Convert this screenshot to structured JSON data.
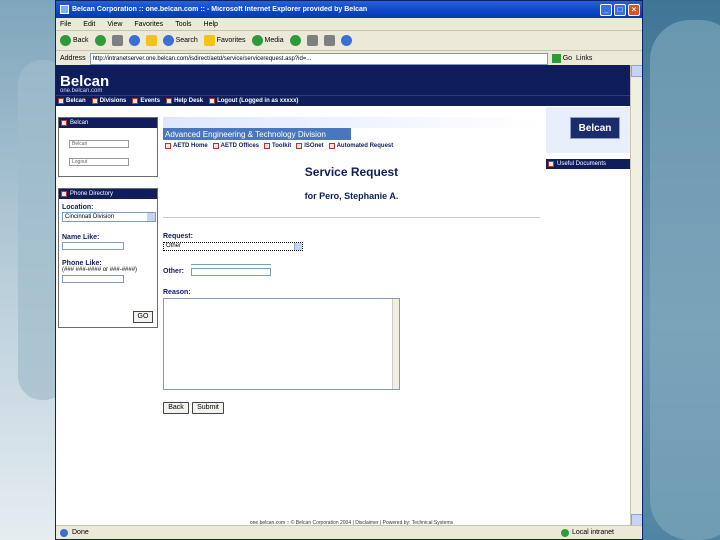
{
  "window": {
    "title": "Belcan Corporation :: one.belcan.com :: - Microsoft Internet Explorer provided by Belcan",
    "buttons": [
      "_",
      "□",
      "×"
    ]
  },
  "menubar": {
    "items": [
      "File",
      "Edit",
      "View",
      "Favorites",
      "Tools",
      "Help"
    ]
  },
  "toolbar": {
    "back": "Back",
    "search": "Search",
    "favorites": "Favorites",
    "media": "Media"
  },
  "address": {
    "label": "Address",
    "url": "http://intranetserver.one.belcan.com/isdirect/aetd/service/servicerequest.asp?id=...",
    "go": "Go",
    "links": "Links"
  },
  "site": {
    "logo": "Belcan",
    "logo_sub": "one.belcan.com",
    "nav": [
      "Belcan",
      "Divisions",
      "Events",
      "Help Desk",
      "Logout (Logged in as xxxxx)"
    ]
  },
  "left_panel_login": {
    "header": "Belcan",
    "field1_placeholder": "Belcan",
    "field2_placeholder": "Logout"
  },
  "left_panel_directory": {
    "header": "Phone Directory",
    "location_label": "Location:",
    "location_value": "Cincinnati Division",
    "name_label": "Name Like:",
    "phone_label": "Phone Like:",
    "phone_hint": "(### ###-#### or ###-####)",
    "go_button": "GO"
  },
  "division": {
    "name": "Advanced Engineering & Technology Division",
    "links": [
      "AETD Home",
      "AETD Offices",
      "Toolkit",
      "ISOnet",
      "Automated Request"
    ]
  },
  "right_panel": {
    "badge": "Belcan",
    "strip": "Useful Documents"
  },
  "form": {
    "title": "Service Request",
    "subtitle": "for Pero, Stephanie A.",
    "request_label": "Request:",
    "request_value": "Other",
    "other_label": "Other:",
    "reason_label": "Reason:",
    "back_button": "Back",
    "submit_button": "Submit"
  },
  "footer": "one.belcan.com :: © Belcan Corporation 2004 | Disclaimer | Powered by: Technical Systems",
  "status": {
    "left": "Done",
    "zone": "Local intranet"
  },
  "colors": {
    "navy": "#0f1d5c",
    "division_bar": "#4a76bd",
    "xp_blue": "#0a46c8"
  }
}
